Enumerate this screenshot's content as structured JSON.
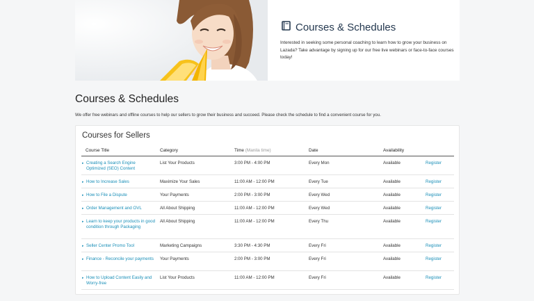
{
  "hero": {
    "title": "Courses & Schedules",
    "icon": "book-icon",
    "description": "Interested in seeking some personal coaching to learn how to grow your business on Lazada? Take advantage by signing up for our free live webinars or face-to-face courses today!"
  },
  "page": {
    "title": "Courses & Schedules",
    "intro": "We offer free webinars and offline courses to help our sellers to grow their business and succeed. Please check the schedule to find a convenient course for you."
  },
  "card": {
    "title": "Courses for Sellers",
    "headers": {
      "course_title": "Course Title",
      "category": "Category",
      "time": "Time",
      "time_note": "(Manila time)",
      "date": "Date",
      "availability": "Availability"
    },
    "rows": [
      {
        "title": "Creating a Search Engine Optimized (SEO) Content",
        "category": "List Your Products",
        "time": "3:00 PM - 4:00 PM",
        "date": "Every Mon",
        "availability": "Available",
        "action": "Register"
      },
      {
        "title": "How to Increase Sales",
        "category": "Maximize Your Sales",
        "time": "11:00 AM - 12:00 PM",
        "date": "Every Tue",
        "availability": "Available",
        "action": "Register"
      },
      {
        "title": "How to File a Dispute",
        "category": "Your Payments",
        "time": "2:00 PM - 3:00 PM",
        "date": "Every Wed",
        "availability": "Available",
        "action": "Register"
      },
      {
        "title": "Order Management and OVL",
        "category": "All About Shipping",
        "time": "11:00 AM - 12:00 PM",
        "date": "Every Wed",
        "availability": "Available",
        "action": "Register"
      },
      {
        "title": "Learn to keep your products in good condition through Packaging",
        "category": "All About Shipping",
        "time": "11:00 AM - 12:00 PM",
        "date": "Every Thu",
        "availability": "Available",
        "action": "Register"
      },
      {
        "title": "Seller Center Promo Tool",
        "category": "Marketing Campaigns",
        "time": "3:30 PM - 4:30 PM",
        "date": "Every Fri",
        "availability": "Available",
        "action": "Register"
      },
      {
        "title": "Finance - Reconcile your payments",
        "category": "Your Payments",
        "time": "2:00 PM - 3:00 PM",
        "date": "Every Fri",
        "availability": "Available",
        "action": "Register"
      },
      {
        "title": "How to Upload Content Easily and Worry-free",
        "category": "List Your Products",
        "time": "11:00 AM - 12:00 PM",
        "date": "Every Fri",
        "availability": "Available",
        "action": "Register"
      }
    ]
  },
  "colors": {
    "link": "#1a8fb8",
    "title_dark": "#24384f",
    "page_bg": "#f5f6f7"
  }
}
